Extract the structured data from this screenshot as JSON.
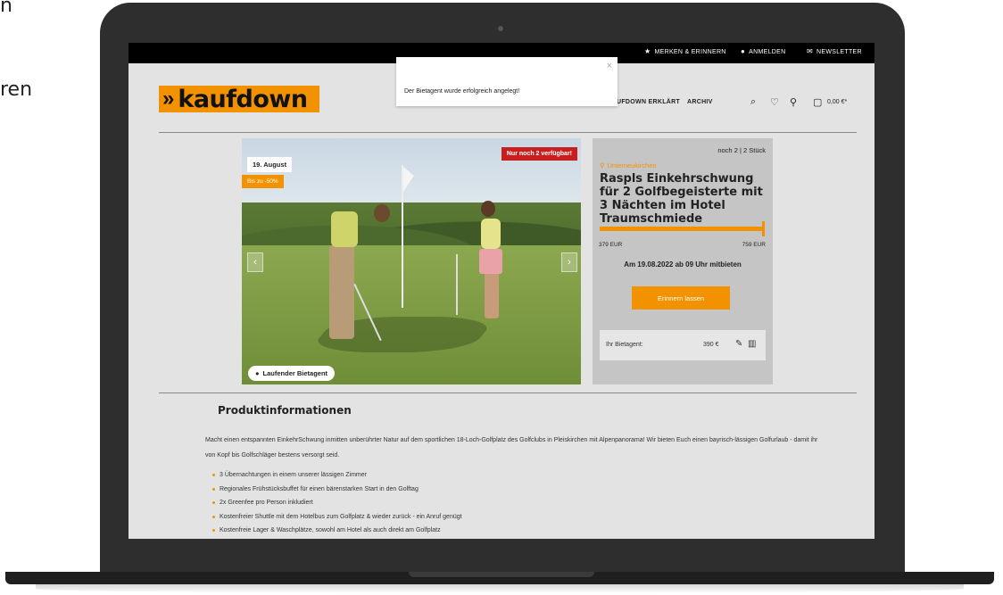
{
  "side_text": [
    "n",
    "ren"
  ],
  "topbar": {
    "remember": "MERKEN & ERINNERN",
    "login": "ANMELDEN",
    "newsletter": "NEWSLETTER"
  },
  "logo": {
    "text": "kaufdown"
  },
  "nav": {
    "explained": "UFDOWN ERKLÄRT",
    "archive": "ARCHIV",
    "cart_total": "0,00 €*"
  },
  "toast": {
    "message": "Der Bietagent wurde erfolgreich angelegt!",
    "close": "×"
  },
  "hero": {
    "date": "19. August",
    "discount": "Bis zu -50%",
    "availability": "Nur noch 2 verfügbar!",
    "running_agent": "Laufender Bietagent",
    "prev": "‹",
    "next": "›"
  },
  "deal": {
    "stock": "noch 2 | 2 Stück",
    "location": "Unterneukirchen",
    "title": "Raspls Einkehrschwung für 2 Golfbegeisterte mit 3 Nächten im Hotel Traumschmiede",
    "price_min": "379 EUR",
    "price_max": "759 EUR",
    "start_info": "Am 19.08.2022 ab 09 Uhr mitbieten",
    "remind_button": "Erinnern lassen",
    "agent_label": "Ihr Bietagent:",
    "agent_value": "390 €"
  },
  "product_info": {
    "heading": "Produktinformationen",
    "description": "Macht einen entspannten EinkehrSchwung inmitten unberührter Natur auf dem sportlichen 18-Loch-Golfplatz des Golfclubs in Pleiskirchen mit Alpenpanorama! Wir bieten Euch einen bayrisch-lässigen Golfurlaub - damit ihr von Kopf bis Golfschläger bestens versorgt seid.",
    "items": [
      "3 Übernachtungen in einem unserer lässigen Zimmer",
      "Regionales Frühstücksbuffet für einen bärenstarken Start in den Golftag",
      "2x Greenfee pro Person inkludiert",
      "Kostenfreier Shuttle mit dem Hotelbus zum Golfplatz & wieder zurück - ein Anruf genügt",
      "Kostenfreie Lager & Waschplätze, sowohl am Hotel als auch direkt am Golfplatz"
    ]
  },
  "colors": {
    "accent": "#f39200",
    "badge_red": "#c71f1f",
    "topbar": "#000000"
  }
}
